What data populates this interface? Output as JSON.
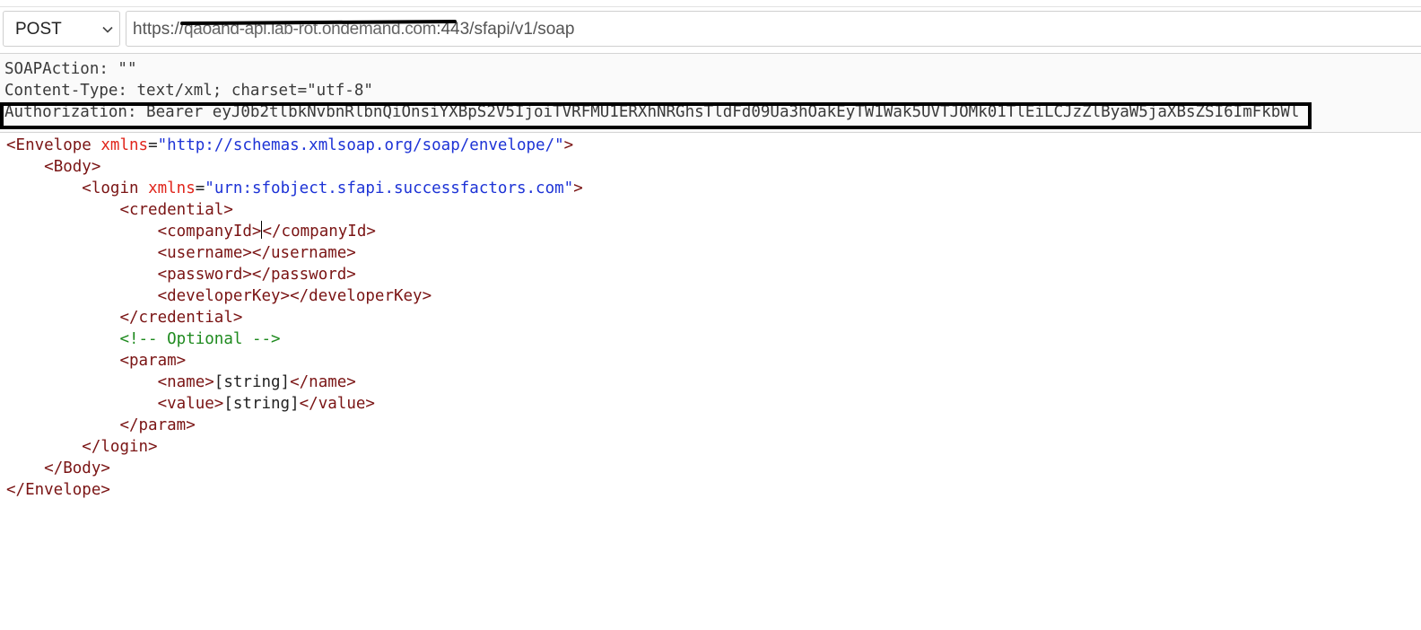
{
  "request": {
    "method": "POST",
    "url_visible": "https://",
    "url_suffix": ":443/sfapi/v1/soap"
  },
  "headers": {
    "soap_action": "SOAPAction: \"\"",
    "content_type": "Content-Type: text/xml; charset=\"utf-8\"",
    "authorization": "Authorization: Bearer eyJ0b2tlbkNvbnRlbnQiOnsiYXBpS2V5IjoiTVRFMU1ERXhNRGhsTldFd09Ua3hOakEyTW1Wak5UVTJOMk01TlEiLCJzZlByaW5jaXBsZSI6ImFkbWl"
  },
  "body": {
    "envelope_open": "<Envelope",
    "envelope_attr": "xmlns",
    "envelope_ns": "\"http://schemas.xmlsoap.org/soap/envelope/\"",
    "gt": ">",
    "eq": "=",
    "body_open": "<Body>",
    "login_open": "<login",
    "login_attr": "xmlns",
    "login_ns": "\"urn:sfobject.sfapi.successfactors.com\"",
    "credential_open": "<credential>",
    "companyid_open": "<companyId>",
    "companyid_close": "</companyId>",
    "username": "<username></username>",
    "password": "<password></password>",
    "developerkey": "<developerKey></developerKey>",
    "credential_close": "</credential>",
    "comment": "<!-- Optional -->",
    "param_open": "<param>",
    "name_open": "<name>",
    "name_value": "[string]",
    "name_close": "</name>",
    "value_open": "<value>",
    "value_value": "[string]",
    "value_close": "</value>",
    "param_close": "</param>",
    "login_close": "</login>",
    "body_close": "</Body>",
    "envelope_close": "</Envelope>"
  },
  "icons": {
    "method_dropdown": "chevron-down-icon"
  }
}
